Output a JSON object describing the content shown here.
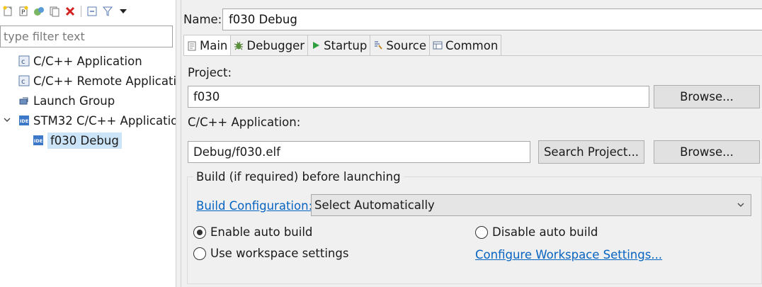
{
  "left": {
    "filter_placeholder": "type filter text",
    "tree": [
      {
        "label": "C/C++ Application",
        "icon": "c-app-icon",
        "level": 1
      },
      {
        "label": "C/C++ Remote Applicatic",
        "icon": "c-app-icon",
        "level": 1
      },
      {
        "label": "Launch Group",
        "icon": "launch-group-icon",
        "level": 1
      },
      {
        "label": "STM32 C/C++ Applicatio",
        "icon": "ide-icon",
        "level": 0,
        "expanded": true
      },
      {
        "label": "f030 Debug",
        "icon": "ide-icon",
        "level": 2,
        "selected": true
      }
    ]
  },
  "right": {
    "name_label": "Name:",
    "name_value": "f030 Debug",
    "tabs": [
      {
        "label": "Main",
        "icon": "main-tab-icon",
        "active": true
      },
      {
        "label": "Debugger",
        "icon": "debugger-icon"
      },
      {
        "label": "Startup",
        "icon": "startup-icon"
      },
      {
        "label": "Source",
        "icon": "source-icon"
      },
      {
        "label": "Common",
        "icon": "common-icon"
      }
    ],
    "project_label": "Project:",
    "project_value": "f030",
    "browse_label": "Browse...",
    "app_label": "C/C++ Application:",
    "app_value": "Debug/f030.elf",
    "search_project_label": "Search Project...",
    "build_group_title": "Build (if required) before launching",
    "build_config_link": "Build Configuration:",
    "build_config_value": "Select Automatically",
    "radio_enable": "Enable auto build",
    "radio_disable": "Disable auto build",
    "radio_workspace": "Use workspace settings",
    "configure_link": "Configure Workspace Settings..."
  }
}
